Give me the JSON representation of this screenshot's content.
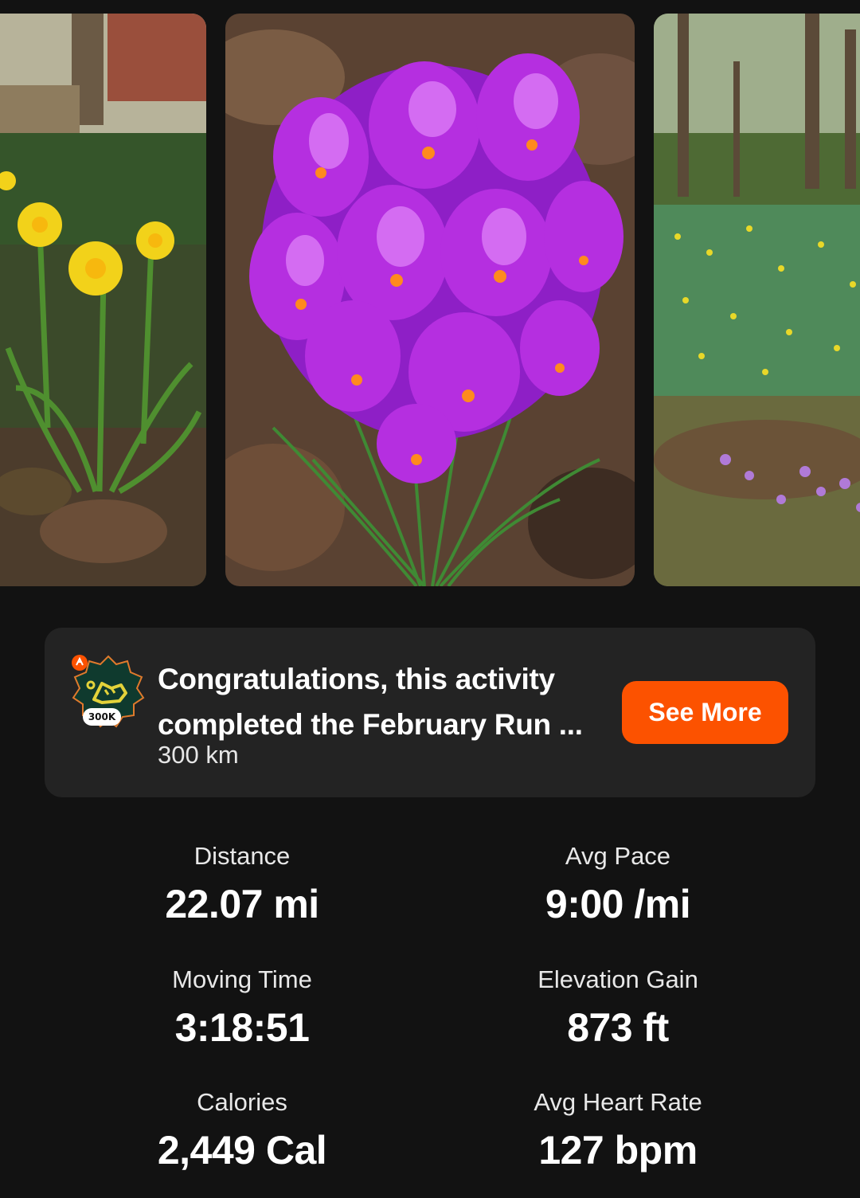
{
  "photos": [
    {
      "subject": "yellow daffodils in garden"
    },
    {
      "subject": "purple crocus flowers"
    },
    {
      "subject": "woodland with daffodils and crocuses"
    }
  ],
  "challenge": {
    "title_line1": "Congratulations, this activity",
    "title_line2": "completed the February Run ...",
    "subtitle": "300 km",
    "badge_label": "300K",
    "badge_icon": "running-shoe-badge-icon",
    "see_more_label": "See More",
    "accent_color": "#fc5200"
  },
  "stats": [
    {
      "label": "Distance",
      "value": "22.07 mi"
    },
    {
      "label": "Avg Pace",
      "value": "9:00 /mi"
    },
    {
      "label": "Moving Time",
      "value": "3:18:51"
    },
    {
      "label": "Elevation Gain",
      "value": "873 ft"
    },
    {
      "label": "Calories",
      "value": "2,449 Cal"
    },
    {
      "label": "Avg Heart Rate",
      "value": "127 bpm"
    }
  ]
}
